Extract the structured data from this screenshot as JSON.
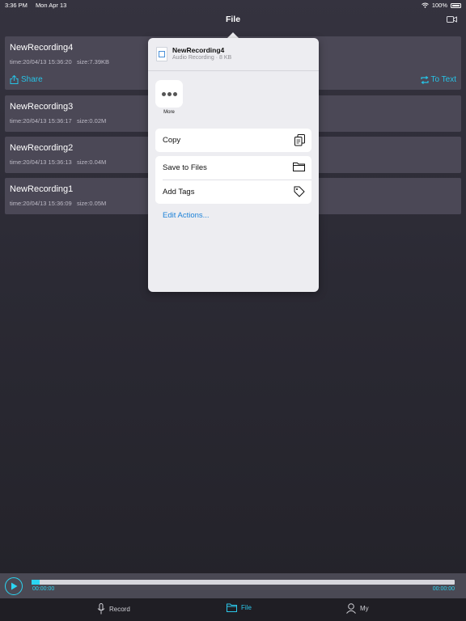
{
  "status_bar": {
    "time": "3:36 PM",
    "date": "Mon Apr 13",
    "battery": "100%"
  },
  "nav": {
    "title": "File"
  },
  "recordings": [
    {
      "name": "NewRecording4",
      "time": "time:20/04/13 15:36:20",
      "size": "size:7.39KB"
    },
    {
      "name": "NewRecording3",
      "time": "time:20/04/13 15:36:17",
      "size": "size:0.02M"
    },
    {
      "name": "NewRecording2",
      "time": "time:20/04/13 15:36:13",
      "size": "size:0.04M"
    },
    {
      "name": "NewRecording1",
      "time": "time:20/04/13 15:36:09",
      "size": "size:0.05M"
    }
  ],
  "card_actions": {
    "share": "Share",
    "to_text": "To Text"
  },
  "share_sheet": {
    "file_title": "NewRecording4",
    "file_subtitle": "Audio Recording · 8 KB",
    "more_label": "More",
    "actions": {
      "copy": "Copy",
      "save_to_files": "Save to Files",
      "add_tags": "Add Tags"
    },
    "edit_actions": "Edit Actions..."
  },
  "player": {
    "current_time": "00:00:00",
    "total_time": "00:00:00",
    "progress": 0.02
  },
  "tabs": {
    "record": "Record",
    "file": "File",
    "my": "My"
  },
  "colors": {
    "accent": "#2bd5f2",
    "link": "#1d82d8"
  }
}
